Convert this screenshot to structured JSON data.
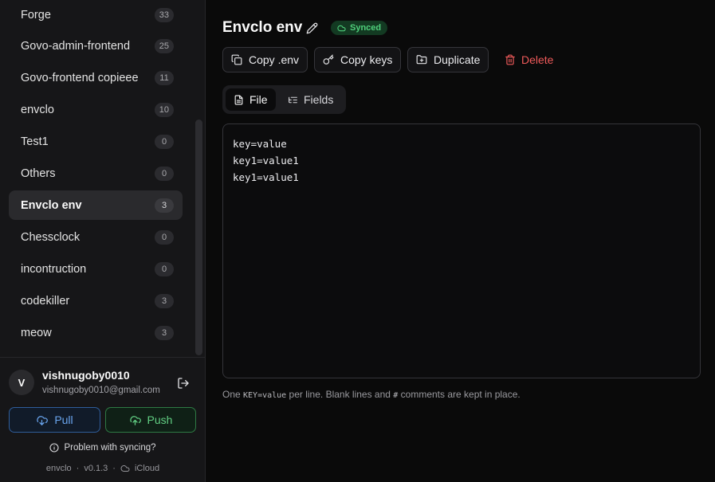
{
  "sidebar": {
    "environments": [
      {
        "name": "Forge",
        "count": "33"
      },
      {
        "name": "Govo-admin-frontend",
        "count": "25"
      },
      {
        "name": "Govo-frontend copieee",
        "count": "11"
      },
      {
        "name": "envclo",
        "count": "10"
      },
      {
        "name": "Test1",
        "count": "0"
      },
      {
        "name": "Others",
        "count": "0"
      },
      {
        "name": "Envclo env",
        "count": "3",
        "active": true
      },
      {
        "name": "Chessclock",
        "count": "0"
      },
      {
        "name": "incontruction",
        "count": "0"
      },
      {
        "name": "codekiller",
        "count": "3"
      },
      {
        "name": "meow",
        "count": "3"
      }
    ],
    "user": {
      "initial": "V",
      "name": "vishnugoby0010",
      "email": "vishnugoby0010@gmail.com"
    },
    "pull_label": "Pull",
    "push_label": "Push",
    "problem_label": "Problem with syncing?",
    "footer": {
      "app": "envclo",
      "version": "v0.1.3",
      "sep": "·",
      "storage": "iCloud"
    }
  },
  "main": {
    "title": "Envclo env",
    "badge": "Synced",
    "actions": {
      "copy_env": "Copy .env",
      "copy_keys": "Copy keys",
      "duplicate": "Duplicate",
      "delete": "Delete"
    },
    "tabs": {
      "file": "File",
      "fields": "Fields"
    },
    "editor_lines": [
      "key=value",
      "key1=value1",
      "key1=value1"
    ],
    "hint": {
      "before": "One ",
      "code": "KEY=value",
      "middle": " per line. Blank lines and ",
      "hash": "#",
      "after": " comments are kept in place."
    }
  },
  "colors": {
    "pull": "#6aa5ee",
    "push": "#62cf83",
    "delete": "#ef5a5a",
    "synced": "#4fcf7b"
  }
}
